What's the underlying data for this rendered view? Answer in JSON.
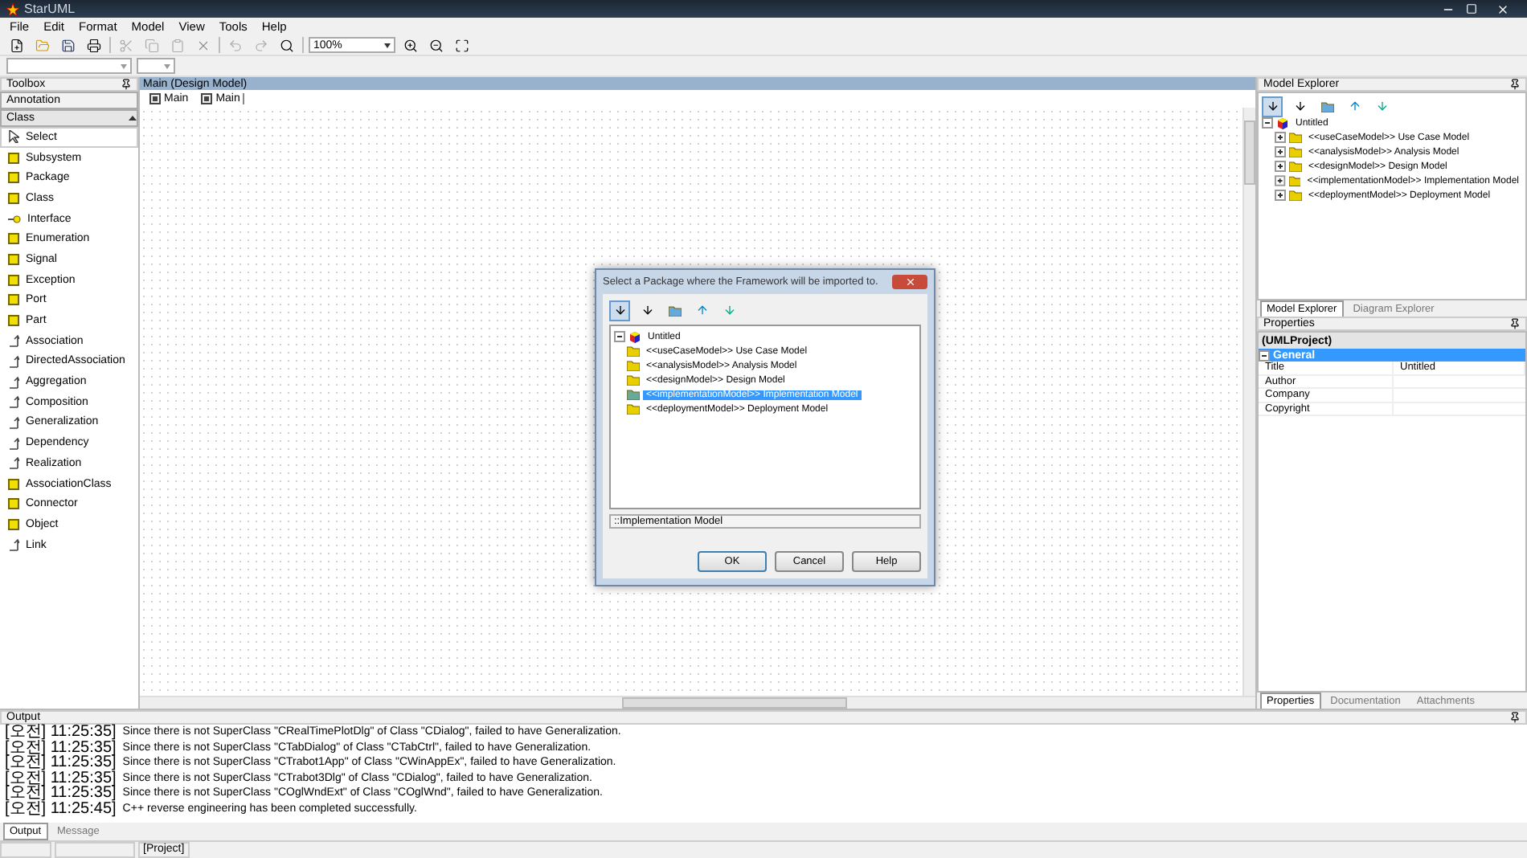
{
  "window": {
    "title": "StarUML"
  },
  "menu": [
    "File",
    "Edit",
    "Format",
    "Model",
    "View",
    "Tools",
    "Help"
  ],
  "toolbar": {
    "zoom": "100%"
  },
  "toolbox": {
    "title": "Toolbox",
    "groups": [
      {
        "label": "Annotation",
        "expanded": false
      },
      {
        "label": "Class",
        "expanded": true
      }
    ],
    "items": [
      {
        "label": "Select",
        "kind": "pointer",
        "selected": true
      },
      {
        "label": "Subsystem",
        "kind": "element",
        "selected": false
      },
      {
        "label": "Package",
        "kind": "element",
        "selected": false
      },
      {
        "label": "Class",
        "kind": "element",
        "selected": false
      },
      {
        "label": "Interface",
        "kind": "lollipop",
        "selected": false
      },
      {
        "label": "Enumeration",
        "kind": "element",
        "selected": false
      },
      {
        "label": "Signal",
        "kind": "element",
        "selected": false
      },
      {
        "label": "Exception",
        "kind": "element",
        "selected": false
      },
      {
        "label": "Port",
        "kind": "element",
        "selected": false
      },
      {
        "label": "Part",
        "kind": "element",
        "selected": false
      },
      {
        "label": "Association",
        "kind": "relation",
        "selected": false
      },
      {
        "label": "DirectedAssociation",
        "kind": "relation",
        "selected": false
      },
      {
        "label": "Aggregation",
        "kind": "relation",
        "selected": false
      },
      {
        "label": "Composition",
        "kind": "relation",
        "selected": false
      },
      {
        "label": "Generalization",
        "kind": "relation",
        "selected": false
      },
      {
        "label": "Dependency",
        "kind": "relation",
        "selected": false
      },
      {
        "label": "Realization",
        "kind": "relation",
        "selected": false
      },
      {
        "label": "AssociationClass",
        "kind": "element",
        "selected": false
      },
      {
        "label": "Connector",
        "kind": "element",
        "selected": false
      },
      {
        "label": "Object",
        "kind": "element",
        "selected": false
      },
      {
        "label": "Link",
        "kind": "relation",
        "selected": false
      }
    ]
  },
  "diagram": {
    "title": "Main (Design Model)",
    "tabs": [
      {
        "label": "Main",
        "selected": false
      },
      {
        "label": "Main",
        "selected": true
      }
    ]
  },
  "model_explorer": {
    "title": "Model Explorer",
    "root": {
      "label": "Untitled",
      "expanded": true,
      "children": [
        {
          "label": "<<useCaseModel>> Use Case Model",
          "expanded": false
        },
        {
          "label": "<<analysisModel>> Analysis Model",
          "expanded": false
        },
        {
          "label": "<<designModel>> Design Model",
          "expanded": false
        },
        {
          "label": "<<implementationModel>> Implementation Model",
          "expanded": false
        },
        {
          "label": "<<deploymentModel>> Deployment Model",
          "expanded": false
        }
      ]
    },
    "tabs": [
      {
        "label": "Model Explorer",
        "selected": true
      },
      {
        "label": "Diagram Explorer",
        "selected": false
      }
    ]
  },
  "properties": {
    "title": "Properties",
    "object": "(UMLProject)",
    "section": "General",
    "rows": [
      {
        "name": "Title",
        "value": "Untitled"
      },
      {
        "name": "Author"
      },
      {
        "name": "Company"
      },
      {
        "name": "Copyright"
      }
    ],
    "tabs": [
      {
        "label": "Properties",
        "selected": true
      },
      {
        "label": "Documentation",
        "selected": false
      },
      {
        "label": "Attachments",
        "selected": false
      }
    ]
  },
  "dialog": {
    "title": "Select a Package where the Framework will be imported to.",
    "root": {
      "label": "Untitled",
      "expanded": true,
      "children": [
        {
          "label": "<<useCaseModel>> Use Case Model",
          "selected": false
        },
        {
          "label": "<<analysisModel>> Analysis Model",
          "selected": false
        },
        {
          "label": "<<designModel>> Design Model",
          "selected": false
        },
        {
          "label": "<<implementationModel>> Implementation Model",
          "selected": true
        },
        {
          "label": "<<deploymentModel>> Deployment Model",
          "selected": false
        }
      ]
    },
    "path": "::Implementation Model",
    "buttons": [
      "OK",
      "Cancel",
      "Help"
    ]
  },
  "output": {
    "title": "Output",
    "lines": [
      {
        "time": "[오전] 11:25:35]",
        "message": "Since there is not SuperClass \"CRealTimePlotDlg\" of Class \"CDialog\", failed to have Generalization."
      },
      {
        "time": "[오전] 11:25:35]",
        "message": "Since there is not SuperClass \"CTabDialog\" of Class \"CTabCtrl\", failed to have Generalization."
      },
      {
        "time": "[오전] 11:25:35]",
        "message": "Since there is not SuperClass \"CTrabot1App\" of Class \"CWinAppEx\", failed to have Generalization."
      },
      {
        "time": "[오전] 11:25:35]",
        "message": "Since there is not SuperClass \"CTrabot3Dlg\" of Class \"CDialog\", failed to have Generalization."
      },
      {
        "time": "[오전] 11:25:35]",
        "message": "Since there is not SuperClass \"COglWndExt\" of Class \"COglWnd\", failed to have Generalization."
      },
      {
        "time": "[오전] 11:25:45]",
        "message": "C++ reverse engineering has been completed successfully."
      }
    ],
    "tabs": [
      {
        "label": "Output",
        "selected": true
      },
      {
        "label": "Message",
        "selected": false
      }
    ]
  },
  "status_bar": [
    "[Project]"
  ]
}
